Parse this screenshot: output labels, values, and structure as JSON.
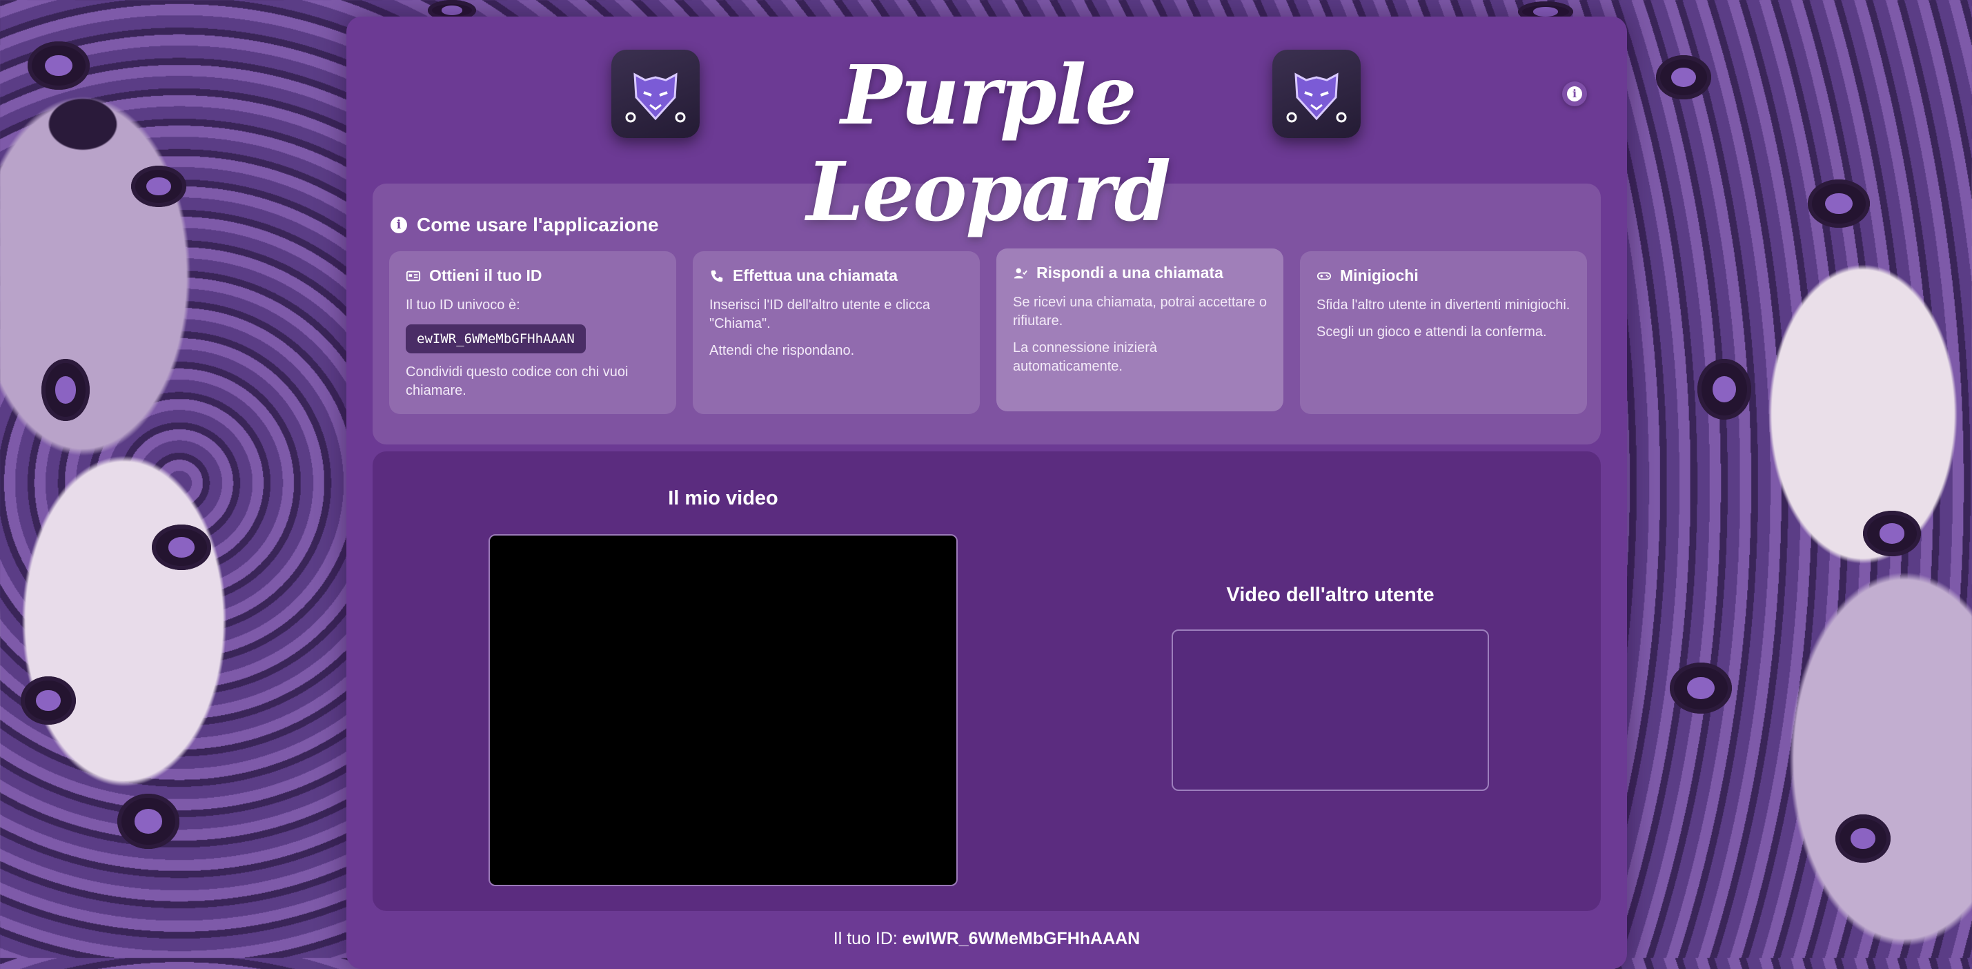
{
  "app": {
    "title": "Purple Leopard"
  },
  "howto": {
    "title": "Come usare l'applicazione",
    "cards": [
      {
        "icon": "id-card-icon",
        "title": "Ottieni il tuo ID",
        "line1": "Il tuo ID univoco è:",
        "code": "ewIWR_6WMeMbGFHhAAAN",
        "line2": "Condividi questo codice con chi vuoi chiamare."
      },
      {
        "icon": "phone-icon",
        "title": "Effettua una chiamata",
        "line1": "Inserisci l'ID dell'altro utente e clicca \"Chiama\".",
        "line2": "Attendi che rispondano."
      },
      {
        "icon": "user-check-icon",
        "title": "Rispondi a una chiamata",
        "line1": "Se ricevi una chiamata, potrai accettare o rifiutare.",
        "line2": "La connessione inizierà automaticamente."
      },
      {
        "icon": "gamepad-icon",
        "title": "Minigiochi",
        "line1": "Sfida l'altro utente in divertenti minigiochi.",
        "line2": "Scegli un gioco e attendi la conferma."
      }
    ]
  },
  "video": {
    "my_label": "Il mio video",
    "remote_label": "Video dell'altro utente"
  },
  "footer": {
    "id_label": "Il tuo ID:",
    "id_value": "ewIWR_6WMeMbGFHhAAAN"
  },
  "colors": {
    "panel": "#6c3a94",
    "accent": "#9b7ab8"
  }
}
